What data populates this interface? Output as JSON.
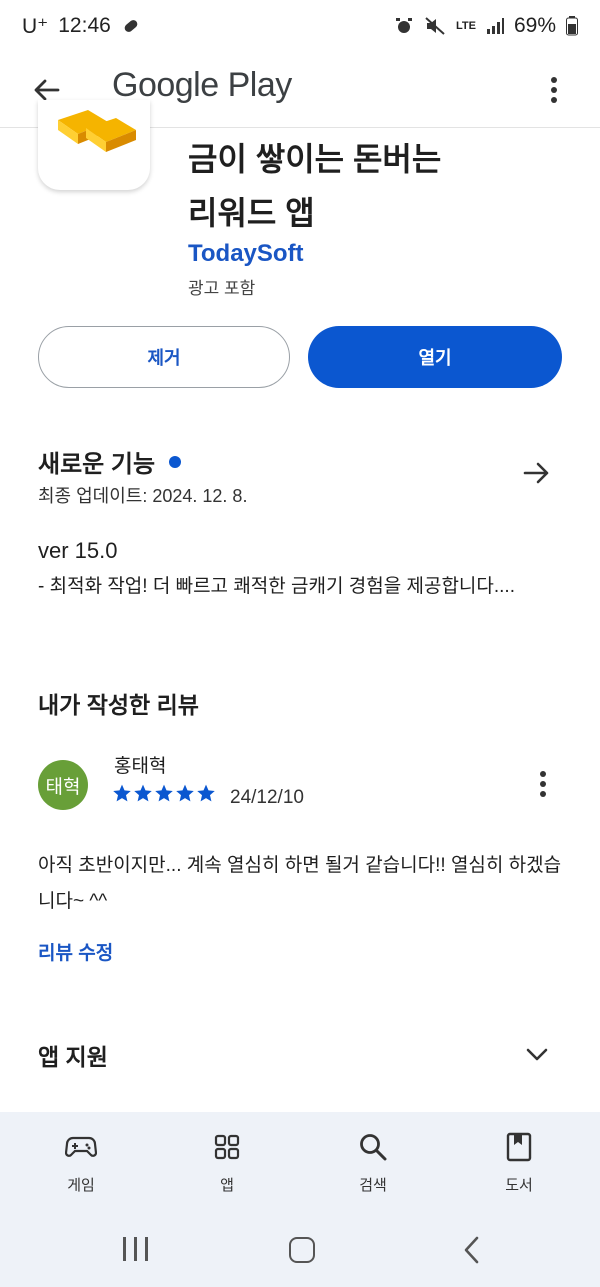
{
  "status_bar": {
    "carrier": "U⁺",
    "time": "12:46",
    "network": "LTE",
    "battery": "69%"
  },
  "app_bar": {
    "title": "Google Play",
    "back_icon": "arrow-back-icon",
    "more_icon": "more-vert-icon"
  },
  "app": {
    "icon": "gold-bars-icon",
    "title_line1": "금이 쌓이는 돈버는",
    "title_line2": "리워드 앱",
    "developer": "TodaySoft",
    "ads": "광고 포함"
  },
  "actions": {
    "remove_label": "제거",
    "open_label": "열기"
  },
  "whats_new": {
    "title": "새로운 기능",
    "updated": "최종 업데이트: 2024. 12. 8.",
    "version": "ver 15.0",
    "notes": "- 최적화 작업! 더 빠르고 쾌적한 금캐기 경험을 제공합니다...."
  },
  "my_review": {
    "section_title": "내가 작성한 리뷰",
    "avatar_text": "태혁",
    "reviewer": "홍태혁",
    "rating": 5,
    "date": "24/12/10",
    "text": "아직 초반이지만... 계속 열심히 하면 될거 같습니다!! 열심히 하겠습니다~ ^^",
    "edit_label": "리뷰 수정"
  },
  "app_support": {
    "title": "앱 지원"
  },
  "bottom_nav": {
    "items": [
      {
        "label": "게임",
        "icon": "gamepad-icon"
      },
      {
        "label": "앱",
        "icon": "apps-grid-icon"
      },
      {
        "label": "검색",
        "icon": "search-icon"
      },
      {
        "label": "도서",
        "icon": "book-icon"
      }
    ]
  },
  "colors": {
    "accent": "#0b57d0",
    "link": "#1a56c4",
    "avatar_bg": "#689f38",
    "nav_bg": "#eef2f8"
  }
}
